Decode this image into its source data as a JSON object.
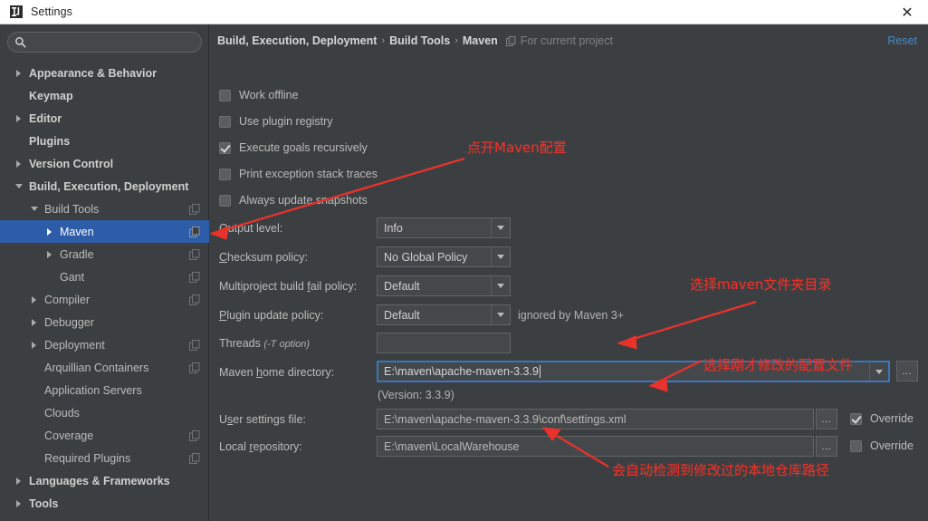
{
  "window": {
    "title": "Settings",
    "app_icon": "intellij-idea-icon",
    "close_label": "✕"
  },
  "sidebar": {
    "search": {
      "value": "",
      "placeholder": "",
      "icon": "search-icon"
    },
    "items": [
      {
        "label": "Appearance & Behavior",
        "indent": 0,
        "twisty": "right",
        "bold": true,
        "selected": false,
        "project_icon": false
      },
      {
        "label": "Keymap",
        "indent": 0,
        "twisty": "none",
        "bold": true,
        "selected": false,
        "project_icon": false
      },
      {
        "label": "Editor",
        "indent": 0,
        "twisty": "right",
        "bold": true,
        "selected": false,
        "project_icon": false
      },
      {
        "label": "Plugins",
        "indent": 0,
        "twisty": "none",
        "bold": true,
        "selected": false,
        "project_icon": false
      },
      {
        "label": "Version Control",
        "indent": 0,
        "twisty": "right",
        "bold": true,
        "selected": false,
        "project_icon": false
      },
      {
        "label": "Build, Execution, Deployment",
        "indent": 0,
        "twisty": "down",
        "bold": true,
        "selected": false,
        "project_icon": false
      },
      {
        "label": "Build Tools",
        "indent": 1,
        "twisty": "down",
        "bold": false,
        "selected": false,
        "project_icon": true
      },
      {
        "label": "Maven",
        "indent": 2,
        "twisty": "right",
        "bold": false,
        "selected": true,
        "project_icon": true
      },
      {
        "label": "Gradle",
        "indent": 2,
        "twisty": "right",
        "bold": false,
        "selected": false,
        "project_icon": true
      },
      {
        "label": "Gant",
        "indent": 2,
        "twisty": "none",
        "bold": false,
        "selected": false,
        "project_icon": true
      },
      {
        "label": "Compiler",
        "indent": 1,
        "twisty": "right",
        "bold": false,
        "selected": false,
        "project_icon": true
      },
      {
        "label": "Debugger",
        "indent": 1,
        "twisty": "right",
        "bold": false,
        "selected": false,
        "project_icon": false
      },
      {
        "label": "Deployment",
        "indent": 1,
        "twisty": "right",
        "bold": false,
        "selected": false,
        "project_icon": true
      },
      {
        "label": "Arquillian Containers",
        "indent": 1,
        "twisty": "none",
        "bold": false,
        "selected": false,
        "project_icon": true
      },
      {
        "label": "Application Servers",
        "indent": 1,
        "twisty": "none",
        "bold": false,
        "selected": false,
        "project_icon": false
      },
      {
        "label": "Clouds",
        "indent": 1,
        "twisty": "none",
        "bold": false,
        "selected": false,
        "project_icon": false
      },
      {
        "label": "Coverage",
        "indent": 1,
        "twisty": "none",
        "bold": false,
        "selected": false,
        "project_icon": true
      },
      {
        "label": "Required Plugins",
        "indent": 1,
        "twisty": "none",
        "bold": false,
        "selected": false,
        "project_icon": true
      },
      {
        "label": "Languages & Frameworks",
        "indent": 0,
        "twisty": "right",
        "bold": true,
        "selected": false,
        "project_icon": false
      },
      {
        "label": "Tools",
        "indent": 0,
        "twisty": "right",
        "bold": true,
        "selected": false,
        "project_icon": false
      }
    ]
  },
  "header": {
    "crumb_1": "Build, Execution, Deployment",
    "crumb_2": "Build Tools",
    "crumb_3": "Maven",
    "separator": "›",
    "scope_icon": "project-scope-icon",
    "scope_text": "For current project",
    "reset_label": "Reset",
    "reset_color": "#4a88c7"
  },
  "main": {
    "checkboxes": [
      {
        "label": "Work offline",
        "checked": false
      },
      {
        "label": "Use plugin registry",
        "checked": false
      },
      {
        "label": "Execute goals recursively",
        "checked": true
      },
      {
        "label": "Print exception stack traces",
        "checked": false
      },
      {
        "label": "Always update snapshots",
        "checked": false
      }
    ],
    "output_level": {
      "label": "Output level:",
      "value": "Info"
    },
    "checksum_policy": {
      "label": "Checksum policy:",
      "value": "No Global Policy"
    },
    "multiproject": {
      "label": "Multiproject build fail policy:",
      "value": "Default"
    },
    "plugin_update": {
      "label": "Plugin update policy:",
      "value": "Default",
      "note": "ignored by Maven 3+"
    },
    "threads": {
      "label": "Threads",
      "label_italic": "(-T option)",
      "value": ""
    },
    "maven_home": {
      "label": "Maven home directory:",
      "value": "E:\\maven\\apache-maven-3.3.9",
      "version_hint": "(Version: 3.3.9)",
      "focused": true
    },
    "user_settings": {
      "label": "User settings file:",
      "value": "E:\\maven\\apache-maven-3.3.9\\conf\\settings.xml",
      "override_label": "Override",
      "override": true
    },
    "local_repo": {
      "label": "Local repository:",
      "value": "E:\\maven\\LocalWarehouse",
      "override_label": "Override",
      "override": false
    },
    "browse_label": "…"
  },
  "annotations": {
    "color": "#e8322b",
    "notes": [
      {
        "text": "点开Maven配置"
      },
      {
        "text": "选择maven文件夹目录"
      },
      {
        "text": "选择刚才修改的配置文件"
      },
      {
        "text": "会自动检测到修改过的本地仓库路径"
      }
    ]
  }
}
